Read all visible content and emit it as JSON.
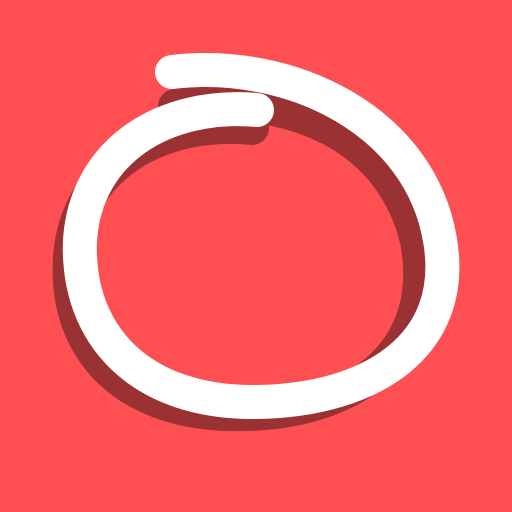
{
  "app_icon": {
    "icon_name": "swirl-loop-icon",
    "colors": {
      "background": "#fe5052",
      "stroke": "#ffffff",
      "shadow": "#9a3133"
    }
  }
}
